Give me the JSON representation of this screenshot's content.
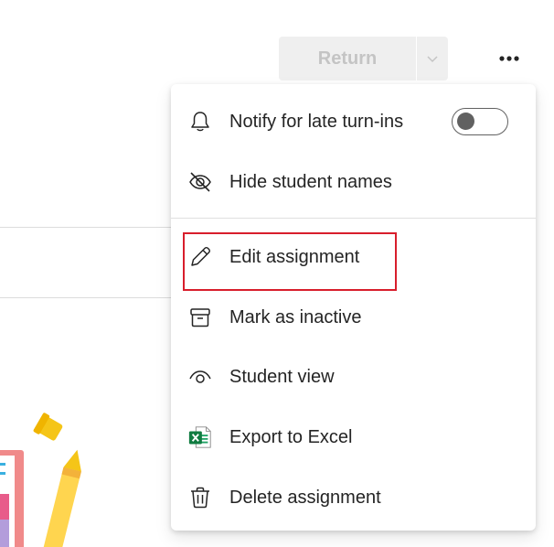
{
  "toolbar": {
    "return_label": "Return",
    "return_icon": "chevron-down-icon",
    "more_icon": "more-options-icon"
  },
  "menu": {
    "items": [
      {
        "label": "Notify for late turn-ins",
        "icon": "bell-icon",
        "toggle_on": false
      },
      {
        "label": "Hide student names",
        "icon": "eye-off-icon"
      },
      {
        "label": "Edit assignment",
        "icon": "pencil-icon",
        "highlighted": true
      },
      {
        "label": "Mark as inactive",
        "icon": "archive-icon"
      },
      {
        "label": "Student view",
        "icon": "eye-icon"
      },
      {
        "label": "Export to Excel",
        "icon": "excel-icon"
      },
      {
        "label": "Delete assignment",
        "icon": "trash-icon"
      }
    ]
  },
  "colors": {
    "highlight_border": "#d81e2c",
    "excel_green": "#107c41",
    "disabled_text": "#c4c4c4"
  }
}
